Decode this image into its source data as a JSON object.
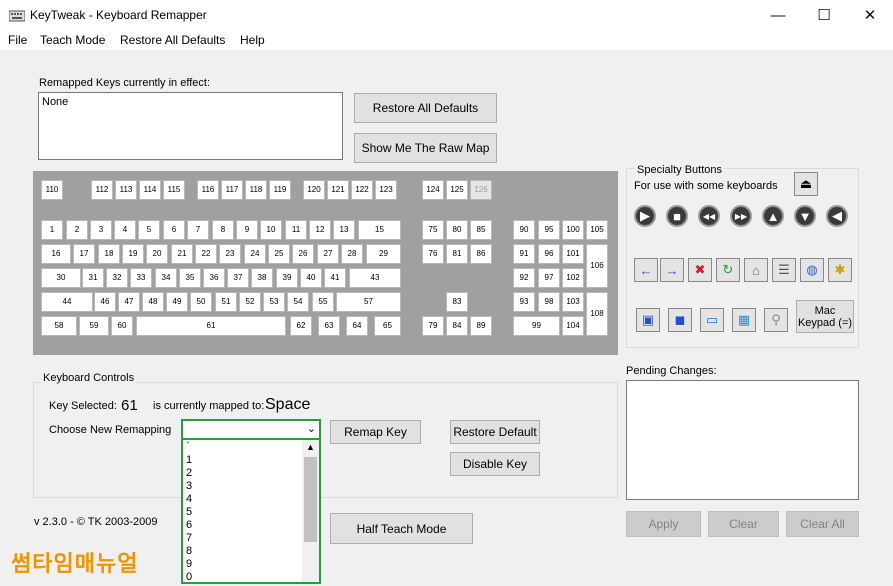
{
  "window": {
    "title": "KeyTweak -  Keyboard Remapper"
  },
  "menu": [
    "File",
    "Teach Mode",
    "Restore All Defaults",
    "Help"
  ],
  "remapped": {
    "label": "Remapped Keys currently in effect:",
    "value": "None"
  },
  "buttons": {
    "restore_all": "Restore All Defaults",
    "raw_map": "Show Me The Raw Map",
    "remap_key": "Remap Key",
    "restore_default": "Restore Default",
    "disable_key": "Disable Key",
    "half_teach": "Half Teach Mode",
    "apply": "Apply",
    "clear": "Clear",
    "clear_all": "Clear All",
    "mac_keypad": "Mac\nKeypad (=)"
  },
  "specialty": {
    "title": "Specialty Buttons",
    "subtitle": "For use with some keyboards",
    "icons": [
      "eject-icon",
      "play-icon",
      "stop-icon",
      "rewind-icon",
      "fast-forward-icon",
      "up-arrow-icon",
      "down-arrow-icon",
      "mute-icon",
      "back-arrow-icon",
      "forward-arrow-icon",
      "stop-x-icon",
      "refresh-icon",
      "home-icon",
      "favorites-icon",
      "web-globe-icon",
      "starburst-icon",
      "my-computer-icon",
      "cube-icon",
      "computer-icon",
      "calculator-icon",
      "search-magnifier-icon"
    ]
  },
  "controls": {
    "group_label": "Keyboard Controls",
    "key_selected_label": "Key Selected:",
    "key_selected_value": "61",
    "mapped_label": "is currently mapped to:",
    "mapped_value": "Space",
    "choose_label": "Choose New Remapping",
    "options": [
      "`",
      "1",
      "2",
      "3",
      "4",
      "5",
      "6",
      "7",
      "8",
      "9",
      "0"
    ]
  },
  "pending": {
    "label": "Pending Changes:"
  },
  "version": "v 2.3.0 - © TK 2003-2009",
  "watermark": "썸타임매뉴얼",
  "keyboard": {
    "rows": [
      [
        "110",
        "112",
        "113",
        "114",
        "115",
        "116",
        "117",
        "118",
        "119",
        "120",
        "121",
        "122",
        "123",
        "124",
        "125",
        "126"
      ],
      [
        "1",
        "2",
        "3",
        "4",
        "5",
        "6",
        "7",
        "8",
        "9",
        "10",
        "11",
        "12",
        "13",
        "15",
        "75",
        "80",
        "85",
        "90",
        "95",
        "100",
        "105"
      ],
      [
        "16",
        "17",
        "18",
        "19",
        "20",
        "21",
        "22",
        "23",
        "24",
        "25",
        "26",
        "27",
        "28",
        "29",
        "76",
        "81",
        "86",
        "91",
        "96",
        "101",
        "106"
      ],
      [
        "30",
        "31",
        "32",
        "33",
        "34",
        "35",
        "36",
        "37",
        "38",
        "39",
        "40",
        "41",
        "43",
        "92",
        "97",
        "102"
      ],
      [
        "44",
        "46",
        "47",
        "48",
        "49",
        "50",
        "51",
        "52",
        "53",
        "54",
        "55",
        "57",
        "83",
        "93",
        "98",
        "103",
        "108"
      ],
      [
        "58",
        "59",
        "60",
        "61",
        "62",
        "63",
        "64",
        "65",
        "79",
        "84",
        "89",
        "99",
        "104"
      ]
    ]
  }
}
